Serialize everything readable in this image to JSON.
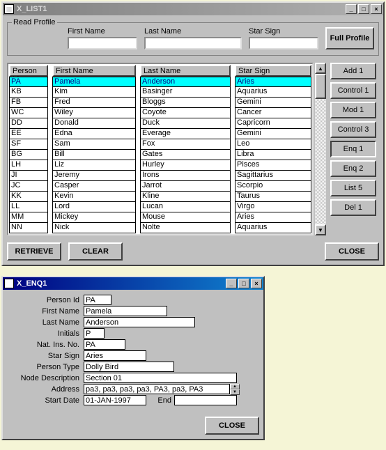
{
  "win1": {
    "title": "X_LIST1",
    "groupLabel": "Read Profile",
    "fnLabel": "First Name",
    "lnLabel": "Last Name",
    "ssLabel": "Star Sign",
    "fullProfile": "Full Profile",
    "cols": [
      "Person Id",
      "First Name",
      "Last Name",
      "Star Sign"
    ],
    "rows": [
      {
        "id": "PA",
        "fn": "Pamela",
        "ln": "Anderson",
        "ss": "Aries"
      },
      {
        "id": "KB",
        "fn": "Kim",
        "ln": "Basinger",
        "ss": "Aquarius"
      },
      {
        "id": "FB",
        "fn": "Fred",
        "ln": "Bloggs",
        "ss": "Gemini"
      },
      {
        "id": "WC",
        "fn": "Wiley",
        "ln": "Coyote",
        "ss": "Cancer"
      },
      {
        "id": "DD",
        "fn": "Donald",
        "ln": "Duck",
        "ss": "Capricorn"
      },
      {
        "id": "EE",
        "fn": "Edna",
        "ln": "Everage",
        "ss": "Gemini"
      },
      {
        "id": "SF",
        "fn": "Sam",
        "ln": "Fox",
        "ss": "Leo"
      },
      {
        "id": "BG",
        "fn": "Bill",
        "ln": "Gates",
        "ss": "Libra"
      },
      {
        "id": "LH",
        "fn": "Liz",
        "ln": "Hurley",
        "ss": "Pisces"
      },
      {
        "id": "JI",
        "fn": "Jeremy",
        "ln": "Irons",
        "ss": "Sagittarius"
      },
      {
        "id": "JC",
        "fn": "Casper",
        "ln": "Jarrot",
        "ss": "Scorpio"
      },
      {
        "id": "KK",
        "fn": "Kevin",
        "ln": "Kline",
        "ss": "Taurus"
      },
      {
        "id": "LL",
        "fn": "Lord",
        "ln": "Lucan",
        "ss": "Virgo"
      },
      {
        "id": "MM",
        "fn": "Mickey",
        "ln": "Mouse",
        "ss": "Aries"
      },
      {
        "id": "NN",
        "fn": "Nick",
        "ln": "Nolte",
        "ss": "Aquarius"
      }
    ],
    "side": [
      "Add 1",
      "Control 1",
      "Mod 1",
      "Control 3",
      "Enq 1",
      "Enq 2",
      "List 5",
      "Del 1"
    ],
    "retrieve": "RETRIEVE",
    "clear": "CLEAR",
    "close": "CLOSE"
  },
  "win2": {
    "title": "X_ENQ1",
    "labels": {
      "pid": "Person Id",
      "fn": "First Name",
      "ln": "Last Name",
      "init": "Initials",
      "nin": "Nat. Ins. No.",
      "ss": "Star Sign",
      "pt": "Person Type",
      "nd": "Node Description",
      "addr": "Address",
      "sd": "Start Date",
      "end": "End"
    },
    "vals": {
      "pid": "PA",
      "fn": "Pamela",
      "ln": "Anderson",
      "init": "P",
      "nin": "PA",
      "ss": "Aries",
      "pt": "Dolly Bird",
      "nd": "Section 01",
      "addr": "pa3, pa3, pa3, pa3, PA3, pa3, PA3",
      "sd": "01-JAN-1997",
      "end": ""
    },
    "close": "CLOSE"
  }
}
